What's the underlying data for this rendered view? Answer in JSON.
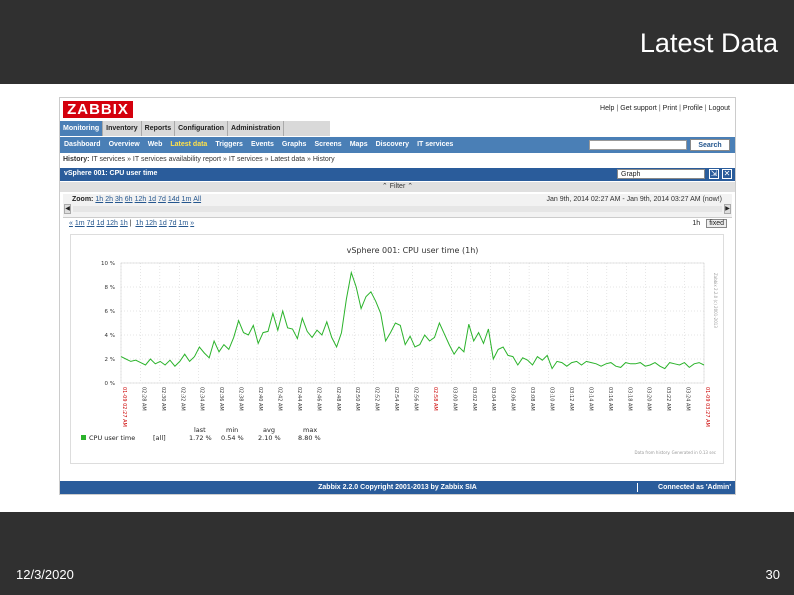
{
  "slide": {
    "title": "Latest Data",
    "date": "12/3/2020",
    "page": "30"
  },
  "zabbix": {
    "logo": "ZABBIX",
    "toplinks": [
      "Help",
      "Get support",
      "Print",
      "Profile",
      "Logout"
    ],
    "main_menu": [
      "Monitoring",
      "Inventory",
      "Reports",
      "Configuration",
      "Administration"
    ],
    "main_menu_active": 0,
    "sub_menu": [
      "Dashboard",
      "Overview",
      "Web",
      "Latest data",
      "Triggers",
      "Events",
      "Graphs",
      "Screens",
      "Maps",
      "Discovery",
      "IT services"
    ],
    "sub_menu_active": 3,
    "search_button": "Search",
    "history_label": "History:",
    "history": [
      "IT services",
      "IT services availability report",
      "IT services",
      "Latest data",
      "History"
    ],
    "history_sep": "»",
    "page_title": "vSphere 001: CPU user time",
    "view_select": "Graph",
    "filter_label": "Filter",
    "zoom_label": "Zoom:",
    "zoom_options": [
      "1h",
      "2h",
      "3h",
      "6h",
      "12h",
      "1d",
      "7d",
      "14d",
      "1m",
      "All"
    ],
    "date_range": "Jan 9th, 2014 02:27 AM  -  Jan 9th, 2014 03:27 AM (now!)",
    "nav_back": "«",
    "nav_options": [
      "1m",
      "7d",
      "1d",
      "12h",
      "1h",
      "|",
      "1h",
      "12h",
      "1d",
      "7d",
      "1m"
    ],
    "nav_forward": "»",
    "period": "1h",
    "fixed_label": "fixed",
    "copyright": "Zabbix 2.2.0 Copyright 2001-2013 by Zabbix SIA",
    "connected": "Connected as 'Admin'"
  },
  "chart_data": {
    "type": "line",
    "title": "vSphere 001: CPU user time (1h)",
    "ylim": [
      0,
      10
    ],
    "yticks": [
      0,
      2,
      4,
      6,
      8,
      10
    ],
    "yunit": " %",
    "xtick_labels": [
      "02:27 AM",
      "02:28 AM",
      "02:30 AM",
      "02:32 AM",
      "02:34 AM",
      "02:36 AM",
      "02:38 AM",
      "02:40 AM",
      "02:42 AM",
      "02:44 AM",
      "02:46 AM",
      "02:48 AM",
      "02:50 AM",
      "02:52 AM",
      "02:54 AM",
      "02:56 AM",
      "02:58 AM",
      "03:00 AM",
      "03:02 AM",
      "03:04 AM",
      "03:06 AM",
      "03:08 AM",
      "03:10 AM",
      "03:12 AM",
      "03:14 AM",
      "03:16 AM",
      "03:18 AM",
      "03:20 AM",
      "03:22 AM",
      "03:24 AM",
      "03:27 AM"
    ],
    "xtick_highlight": [
      0,
      16,
      30
    ],
    "first_label": "01-09 02:27 AM",
    "last_label": "01-09 03:27 AM",
    "series": [
      {
        "name": "CPU user time",
        "color": "#2bb32b",
        "function": "[all]",
        "last": "1.72 %",
        "min": "0.54 %",
        "avg": "2.10 %",
        "max": "8.80 %",
        "values": [
          2.2,
          2.0,
          1.8,
          1.9,
          1.7,
          1.5,
          2.0,
          1.6,
          1.8,
          1.5,
          1.9,
          1.4,
          1.8,
          2.4,
          1.8,
          2.2,
          3.0,
          2.5,
          2.1,
          3.5,
          2.6,
          3.2,
          2.8,
          3.8,
          5.2,
          4.2,
          4.0,
          4.8,
          3.3,
          4.2,
          4.3,
          5.8,
          4.4,
          6.0,
          4.6,
          4.5,
          3.7,
          5.4,
          4.3,
          3.8,
          4.4,
          4.0,
          5.1,
          3.8,
          3.0,
          4.2,
          7.0,
          9.2,
          8.0,
          6.2,
          7.2,
          7.6,
          6.8,
          5.8,
          3.5,
          4.2,
          5.0,
          4.8,
          3.2,
          3.9,
          3.0,
          3.2,
          4.0,
          3.5,
          3.8,
          5.0,
          4.1,
          3.2,
          2.4,
          3.0,
          2.6,
          4.9,
          3.5,
          4.2,
          3.3,
          4.5,
          2.0,
          2.8,
          3.0,
          2.3,
          2.2,
          1.5,
          2.1,
          1.9,
          1.5,
          2.2,
          1.9,
          2.3,
          1.2,
          1.8,
          1.7,
          1.4,
          1.7,
          1.8,
          1.5,
          1.8,
          1.7,
          1.6,
          1.4,
          1.6,
          1.7,
          1.4,
          1.3,
          1.7,
          1.6,
          1.6,
          1.7,
          1.4,
          1.5,
          1.7,
          1.4,
          1.2,
          1.7,
          1.6,
          1.5,
          1.7,
          1.3,
          1.6,
          1.7,
          1.5
        ]
      }
    ],
    "legend_headers": [
      "last",
      "min",
      "avg",
      "max"
    ],
    "side_label": "Zabbix 2.2.0 (c) 2001-2013",
    "watermark": "Data from history. Generated in 0.13 sec"
  }
}
